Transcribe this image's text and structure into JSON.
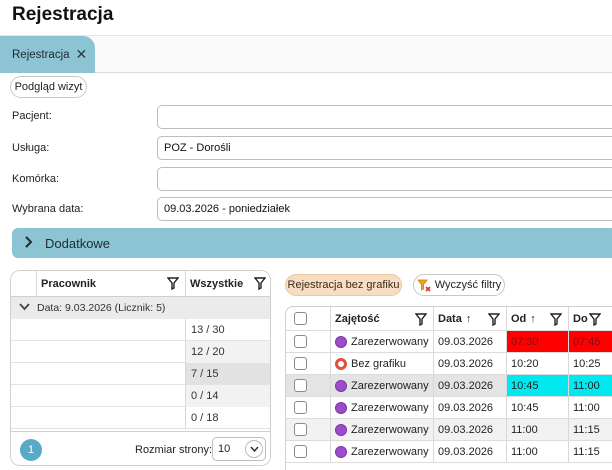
{
  "page": {
    "title": "Rejestracja"
  },
  "tabs": [
    {
      "label": "Rejestracja",
      "close": "✕"
    }
  ],
  "toolbar": {
    "podglad_label": "Podgląd wizyt"
  },
  "form": {
    "pacjent_label": "Pacjent:",
    "pacjent_value": "",
    "usluga_label": "Usługa:",
    "usluga_value": "POZ - Dorośli",
    "komorka_label": "Komórka:",
    "komorka_value": "",
    "data_label": "Wybrana data:",
    "data_value": "09.03.2026 - poniedziałek"
  },
  "dodatkowe": {
    "label": "Dodatkowe"
  },
  "left_grid": {
    "columns": [
      "Pracownik",
      "Wszystkie"
    ],
    "group_label": "Data: 9.03.2026 (Licznik: 5)",
    "rows": [
      "13 / 30",
      "12 / 20",
      "7 / 15",
      "0 / 14",
      "0 / 18"
    ],
    "page": "1",
    "page_size_label": "Rozmiar strony:",
    "page_size": "10"
  },
  "right_toolbar": {
    "rej_label": "Rejestracja bez grafiku",
    "clear_label": "Wyczyść filtry"
  },
  "right_grid": {
    "columns": [
      "Zajętość",
      "Data",
      "Od",
      "Do"
    ],
    "rows": [
      {
        "status": "Zarezerwowany",
        "icon": "purple",
        "date": "09.03.2026",
        "od": "07:30",
        "do": "07:45",
        "color": "#ff0000"
      },
      {
        "status": "Bez grafiku",
        "icon": "ring",
        "date": "09.03.2026",
        "od": "10:20",
        "do": "10:25",
        "color": ""
      },
      {
        "status": "Zarezerwowany",
        "icon": "purple",
        "date": "09.03.2026",
        "od": "10:45",
        "do": "11:00",
        "color": "#00e8f0"
      },
      {
        "status": "Zarezerwowany",
        "icon": "purple",
        "date": "09.03.2026",
        "od": "10:45",
        "do": "11:00",
        "color": ""
      },
      {
        "status": "Zarezerwowany",
        "icon": "purple",
        "date": "09.03.2026",
        "od": "11:00",
        "do": "11:15",
        "color": ""
      },
      {
        "status": "Zarezerwowany",
        "icon": "purple",
        "date": "09.03.2026",
        "od": "11:00",
        "do": "11:15",
        "color": ""
      }
    ]
  },
  "icons": {
    "filter": "filter-icon",
    "sort_asc": "arrow-up-icon",
    "expand": "chevron-right-icon",
    "collapse": "chevron-down-icon"
  },
  "colors": {
    "accent": "#8dc4d4",
    "page_badge": "#59aac8",
    "rej_button": "#f7ddc4"
  }
}
